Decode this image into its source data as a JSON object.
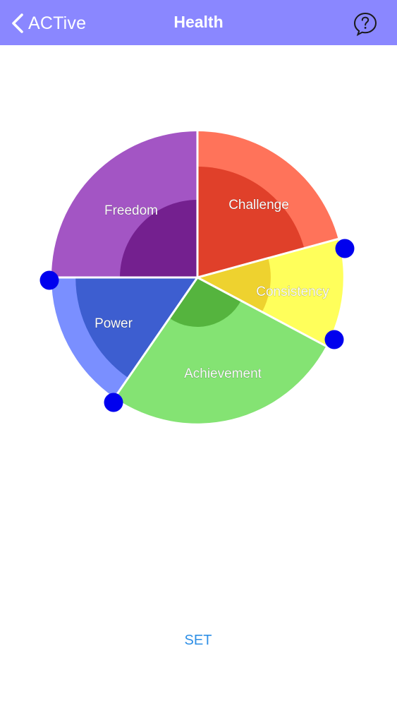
{
  "navbar": {
    "back_label": "ACTive",
    "title": "Health",
    "background": "#8a87ff",
    "back_icon": "chevron-left-icon",
    "help_icon": "question-bubble-icon"
  },
  "wheel": {
    "segments": [
      {
        "key": "freedom",
        "label": "Freedom",
        "outer_color": "#a355c4",
        "inner_color": "#74208f"
      },
      {
        "key": "challenge",
        "label": "Challenge",
        "outer_color": "#ff735a",
        "inner_color": "#e0402a"
      },
      {
        "key": "consistency",
        "label": "Consistency",
        "outer_color": "#ffff5b",
        "inner_color": "#eed22f"
      },
      {
        "key": "achievement",
        "label": "Achievement",
        "outer_color": "#84e373",
        "inner_color": "#55b43e"
      },
      {
        "key": "power",
        "label": "Power",
        "outer_color": "#7a8fff",
        "inner_color": "#3d5ed0"
      }
    ],
    "handle_color": "#0000ee"
  },
  "footer": {
    "set_label": "SET",
    "set_color": "#2e8fe6"
  }
}
